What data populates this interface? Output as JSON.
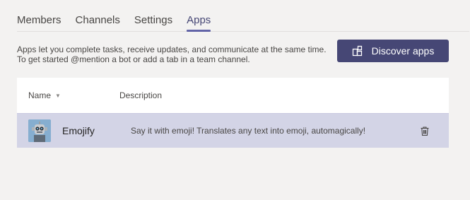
{
  "tabs": [
    {
      "label": "Members",
      "active": false
    },
    {
      "label": "Channels",
      "active": false
    },
    {
      "label": "Settings",
      "active": false
    },
    {
      "label": "Apps",
      "active": true
    }
  ],
  "intro": {
    "line1": "Apps let you complete tasks, receive updates, and communicate at the same time.",
    "line2": "To get started @mention a bot or add a tab in a team channel."
  },
  "discover_button": {
    "label": "Discover apps",
    "icon": "store-icon"
  },
  "table": {
    "headers": {
      "name": "Name",
      "description": "Description"
    },
    "sort_indicator": "sort-down-icon",
    "rows": [
      {
        "name": "Emojify",
        "description": "Say it with emoji! Translates any text into emoji, automagically!",
        "icon": "robot-avatar",
        "action_icon": "trash-icon"
      }
    ]
  },
  "colors": {
    "accent": "#6264a7",
    "button": "#464775",
    "row_selected": "#d3d4e6",
    "background": "#f3f2f1"
  }
}
